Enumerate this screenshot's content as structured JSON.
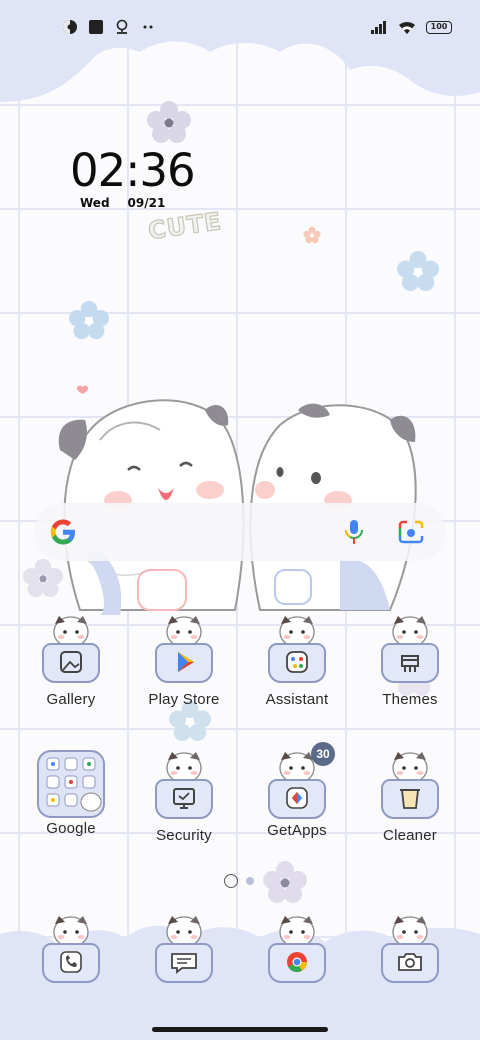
{
  "status_bar": {
    "left_icons": [
      "data-saver-icon",
      "square-icon",
      "location-icon",
      "more-dots-icon"
    ],
    "right_icons": [
      "signal-icon",
      "wifi-icon",
      "battery-icon"
    ],
    "battery_level": "100"
  },
  "clock": {
    "time": "02:36",
    "day": "Wed",
    "date": "09/21"
  },
  "wallpaper_text": "CUTE",
  "search_bar": {
    "icons": [
      "google-g-icon",
      "microphone-icon",
      "lens-icon"
    ]
  },
  "apps_row1": [
    {
      "label": "Gallery",
      "icon": "gallery-icon"
    },
    {
      "label": "Play Store",
      "icon": "play-store-icon"
    },
    {
      "label": "Assistant",
      "icon": "assistant-icon"
    },
    {
      "label": "Themes",
      "icon": "themes-icon"
    }
  ],
  "apps_row2": [
    {
      "label": "Google",
      "icon": "google-folder-icon"
    },
    {
      "label": "Security",
      "icon": "security-icon"
    },
    {
      "label": "GetApps",
      "icon": "getapps-icon",
      "badge": "30"
    },
    {
      "label": "Cleaner",
      "icon": "cleaner-icon"
    }
  ],
  "page_indicator": {
    "pages": 2,
    "current": 1
  },
  "dock": [
    {
      "icon": "phone-icon"
    },
    {
      "icon": "messages-icon"
    },
    {
      "icon": "chrome-icon"
    },
    {
      "icon": "camera-icon"
    }
  ],
  "colors": {
    "accent": "#dfe4f6",
    "outline": "#8f9ac4",
    "badge": "#5c6a8a"
  }
}
